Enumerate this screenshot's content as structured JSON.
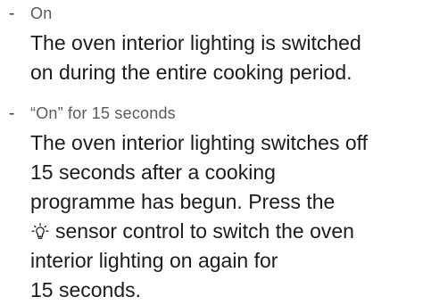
{
  "bullet": "-",
  "items": [
    {
      "option": "On",
      "description_lines": [
        "The oven interior lighting is switched",
        "on during the entire cooking period."
      ]
    },
    {
      "option": "“On” for 15 seconds",
      "description_lines": [
        "The oven interior lighting switches off",
        "15 seconds after a cooking",
        "programme has begun. Press the",
        "sensor control to switch the oven",
        "interior lighting on again for",
        "15 seconds."
      ],
      "icon": "light-bulb-icon"
    }
  ]
}
